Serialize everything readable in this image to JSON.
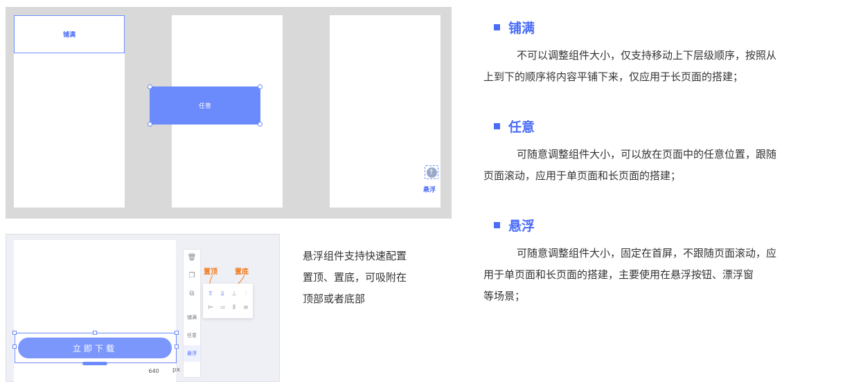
{
  "demo": {
    "fill_label": "铺满",
    "any_label": "任意",
    "float_label": "悬浮"
  },
  "editor": {
    "download_button": "立即下载",
    "width_value": "640",
    "width_unit": "px",
    "modes": {
      "fill": "铺满",
      "any": "任意",
      "float": "悬浮"
    },
    "callout_top": "置顶",
    "callout_bottom": "置底"
  },
  "caption": {
    "line1": "悬浮组件支持快速配置",
    "line2": "置顶、置底，可吸附在",
    "line3": "顶部或者底部"
  },
  "sections": {
    "fill": {
      "title": "铺满",
      "line1": "不可以调整组件大小，仅支持移动上下层级顺序，按照从",
      "line2": "上到下的顺序将内容平铺下来，仅应用于长页面的搭建；"
    },
    "any": {
      "title": "任意",
      "line1": "可随意调整组件大小，可以放在页面中的任意位置，跟随",
      "line2": "页面滚动，应用于单页面和长页面的搭建；"
    },
    "float": {
      "title": "悬浮",
      "line1": "可随意调整组件大小，固定在首屏，不跟随页面滚动，应",
      "line2": "用于单页面和长页面的搭建，主要使用在悬浮按钮、漂浮窗",
      "line3": "等场景；"
    }
  },
  "colors": {
    "accent": "#4a6cf7",
    "block": "#6b8afc",
    "callout": "#f07b20",
    "panel": "#d9d9d9"
  },
  "icons": [
    "delete-icon",
    "copy-icon",
    "layer-icon",
    "arrow-up-circle-icon"
  ]
}
